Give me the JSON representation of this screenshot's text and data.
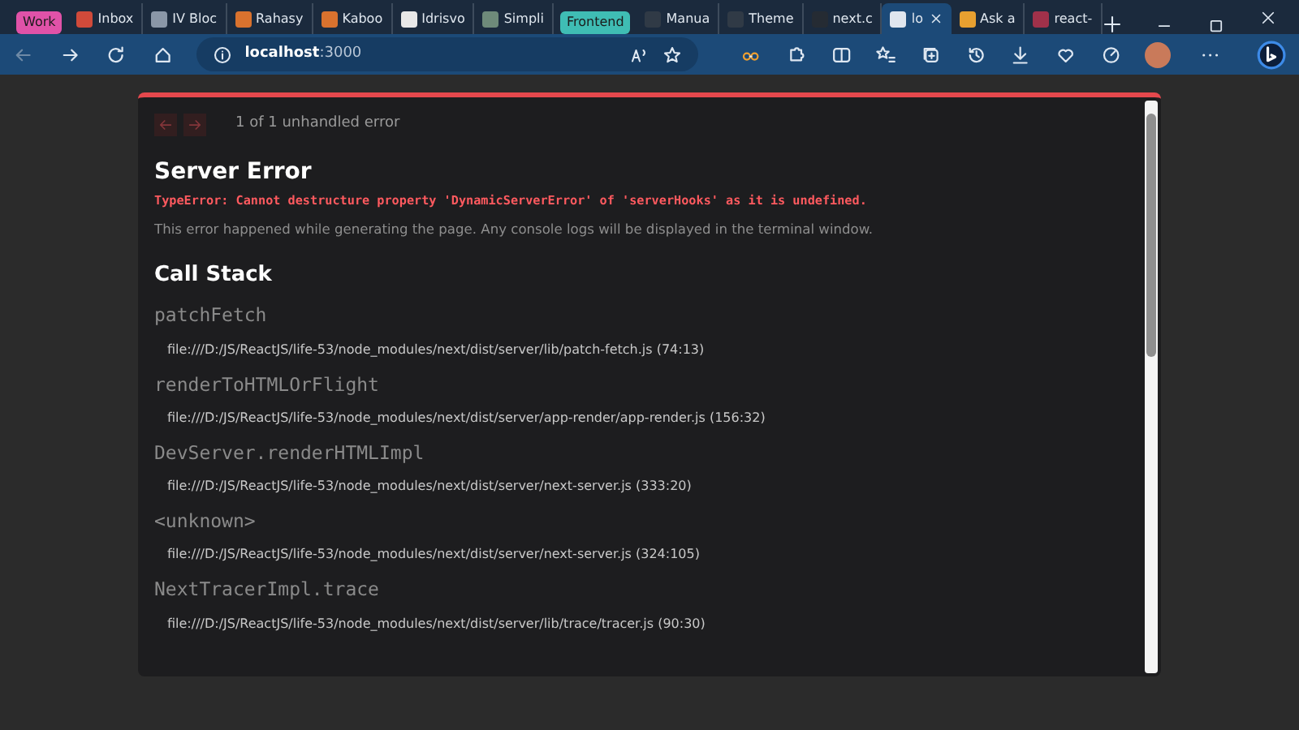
{
  "tabs": [
    {
      "kind": "group",
      "label": "Work",
      "color": "#e052a8"
    },
    {
      "kind": "tab",
      "label": "Inbox",
      "selected": false
    },
    {
      "kind": "tab",
      "label": "IV Bloc",
      "selected": false
    },
    {
      "kind": "tab",
      "label": "Rahasy",
      "selected": false
    },
    {
      "kind": "tab",
      "label": "Kaboo",
      "selected": false
    },
    {
      "kind": "tab",
      "label": "Idrisvo",
      "selected": false
    },
    {
      "kind": "tab",
      "label": "Simpli",
      "selected": false
    },
    {
      "kind": "group",
      "label": "Frontend",
      "color": "#3fbdb4"
    },
    {
      "kind": "tab",
      "label": "Manua",
      "selected": false
    },
    {
      "kind": "tab",
      "label": "Theme",
      "selected": false
    },
    {
      "kind": "tab",
      "label": "next.c",
      "selected": false
    },
    {
      "kind": "tab",
      "label": "lo",
      "selected": true
    },
    {
      "kind": "tab",
      "label": "Ask a",
      "selected": false
    },
    {
      "kind": "tab",
      "label": "react-",
      "selected": false
    }
  ],
  "address": {
    "host": "localhost",
    "port": ":3000"
  },
  "error_dialog": {
    "counter": "1 of 1 unhandled error",
    "prev_disabled": true,
    "next_disabled": true,
    "title": "Server Error",
    "message": "TypeError: Cannot destructure property 'DynamicServerError' of 'serverHooks' as it is undefined.",
    "description": "This error happened while generating the page. Any console logs will be displayed in the terminal window.",
    "stack_title": "Call Stack",
    "frames": [
      {
        "function": "patchFetch",
        "location": "file:///D:/JS/ReactJS/life-53/node_modules/next/dist/server/lib/patch-fetch.js (74:13)"
      },
      {
        "function": "renderToHTMLOrFlight",
        "location": "file:///D:/JS/ReactJS/life-53/node_modules/next/dist/server/app-render/app-render.js (156:32)"
      },
      {
        "function": "DevServer.renderHTMLImpl",
        "location": "file:///D:/JS/ReactJS/life-53/node_modules/next/dist/server/next-server.js (333:20)"
      },
      {
        "function": "<unknown>",
        "location": "file:///D:/JS/ReactJS/life-53/node_modules/next/dist/server/next-server.js (324:105)"
      },
      {
        "function": "NextTracerImpl.trace",
        "location": "file:///D:/JS/ReactJS/life-53/node_modules/next/dist/server/lib/trace/tracer.js (90:30)"
      }
    ]
  }
}
